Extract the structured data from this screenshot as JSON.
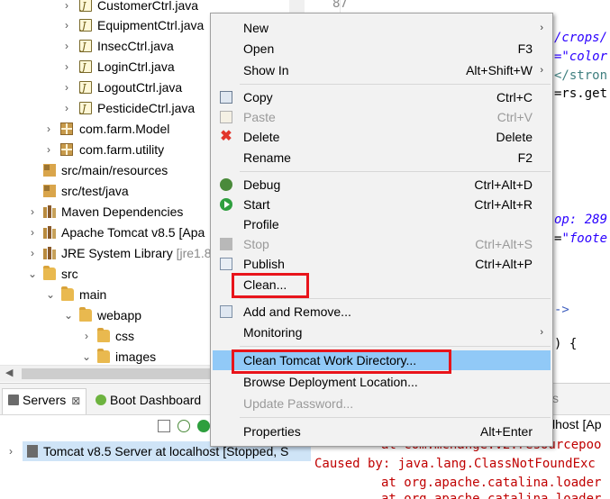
{
  "tree": {
    "items": [
      {
        "label": "CustomerCtrl.java",
        "icon": "java-file-icon"
      },
      {
        "label": "EquipmentCtrl.java",
        "icon": "java-file-icon"
      },
      {
        "label": "InsecCtrl.java",
        "icon": "java-file-icon"
      },
      {
        "label": "LoginCtrl.java",
        "icon": "java-file-icon"
      },
      {
        "label": "LogoutCtrl.java",
        "icon": "java-file-icon"
      },
      {
        "label": "PesticideCtrl.java",
        "icon": "java-file-icon"
      },
      {
        "label": "com.farm.Model",
        "icon": "package-icon"
      },
      {
        "label": "com.farm.utility",
        "icon": "package-icon"
      },
      {
        "label": "src/main/resources",
        "icon": "source-folder-icon"
      },
      {
        "label": "src/test/java",
        "icon": "source-folder-icon"
      },
      {
        "label": "Maven Dependencies",
        "icon": "library-icon"
      },
      {
        "label": "Apache Tomcat v8.5 [Apa",
        "icon": "library-icon"
      },
      {
        "label": "JRE System Library",
        "suffix": "[jre1.8",
        "icon": "library-icon"
      },
      {
        "label": "src",
        "icon": "folder-icon"
      },
      {
        "label": "main",
        "icon": "folder-icon"
      },
      {
        "label": "webapp",
        "icon": "folder-icon"
      },
      {
        "label": "css",
        "icon": "folder-icon"
      },
      {
        "label": "images",
        "icon": "folder-icon"
      }
    ]
  },
  "editor": {
    "line_number": "87",
    "fragments": {
      "f1": "/crops/",
      "f2": "=\"color",
      "f3": "</stron",
      "f4": "=rs.get",
      "f5a": "op: ",
      "f5b": "289",
      "f6a": "=",
      "f6b": "\"foote",
      "f7": "->",
      "f8": ") {"
    }
  },
  "servers_view": {
    "tabs": [
      {
        "label": "Servers",
        "close": "⊠"
      },
      {
        "label": "Boot Dashboard"
      }
    ],
    "server_row": "Tomcat v8.5 Server at localhost  [Stopped, S"
  },
  "console": {
    "tab_fragment": "s",
    "title": "lhost [Ap",
    "lines": [
      "at com.mchange.v2.resourcepoo",
      "Caused by: java.lang.ClassNotFoundExc",
      "at org.apache.catalina.loader",
      "at org.apache.catalina.loader"
    ]
  },
  "context_menu": {
    "items": {
      "new": {
        "label": "New"
      },
      "open": {
        "label": "Open",
        "shortcut": "F3"
      },
      "show_in": {
        "label": "Show In",
        "shortcut": "Alt+Shift+W"
      },
      "copy": {
        "label": "Copy",
        "shortcut": "Ctrl+C"
      },
      "paste": {
        "label": "Paste",
        "shortcut": "Ctrl+V"
      },
      "delete": {
        "label": "Delete",
        "shortcut": "Delete"
      },
      "rename": {
        "label": "Rename",
        "shortcut": "F2"
      },
      "debug": {
        "label": "Debug",
        "shortcut": "Ctrl+Alt+D"
      },
      "start": {
        "label": "Start",
        "shortcut": "Ctrl+Alt+R"
      },
      "profile": {
        "label": "Profile"
      },
      "stop": {
        "label": "Stop",
        "shortcut": "Ctrl+Alt+S"
      },
      "publish": {
        "label": "Publish",
        "shortcut": "Ctrl+Alt+P"
      },
      "clean": {
        "label": "Clean..."
      },
      "add_remove": {
        "label": "Add and Remove..."
      },
      "monitoring": {
        "label": "Monitoring"
      },
      "clean_work_dir": {
        "label": "Clean Tomcat Work Directory..."
      },
      "browse_deploy": {
        "label": "Browse Deployment Location..."
      },
      "update_password": {
        "label": "Update Password..."
      },
      "properties": {
        "label": "Properties",
        "shortcut": "Alt+Enter"
      }
    },
    "submenu_arrow": "›",
    "highlight_color": "#91c9f7",
    "annotation_color": "#e8141b"
  }
}
